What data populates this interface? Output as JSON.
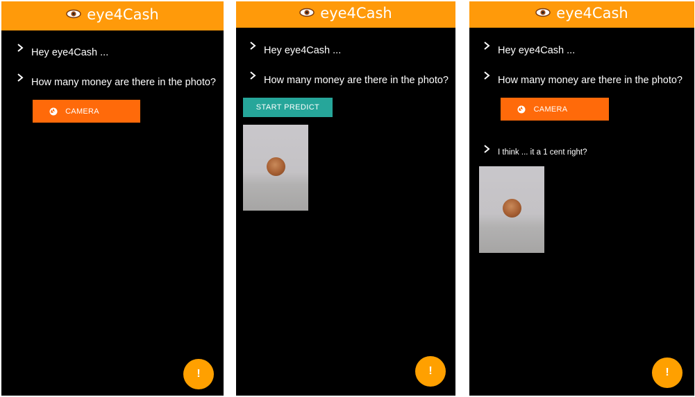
{
  "colors": {
    "appbar": "#ff9a0a",
    "camera_button": "#ff6a0a",
    "predict_button": "#26a69a",
    "fab": "#ffa000",
    "screen_background": "#000000"
  },
  "app": {
    "title": "eye4Cash",
    "logo_icon": "eye-icon"
  },
  "screens": [
    {
      "messages": [
        "Hey eye4Cash ...",
        "How many money are there in the photo?"
      ],
      "camera_button": {
        "label": "CAMERA",
        "icon": "shutter-icon"
      },
      "fab_label": "!"
    },
    {
      "messages": [
        "Hey eye4Cash ...",
        "How many money are there in the photo?"
      ],
      "predict_button": {
        "label": "START PREDICT"
      },
      "photo": {
        "subject": "coin"
      },
      "fab_label": "!"
    },
    {
      "messages": [
        "Hey eye4Cash ...",
        "How many money are there in the photo?"
      ],
      "camera_button": {
        "label": "CAMERA",
        "icon": "shutter-icon"
      },
      "result": "I think ... it a 1 cent right?",
      "photo": {
        "subject": "coin"
      },
      "fab_label": "!"
    }
  ]
}
